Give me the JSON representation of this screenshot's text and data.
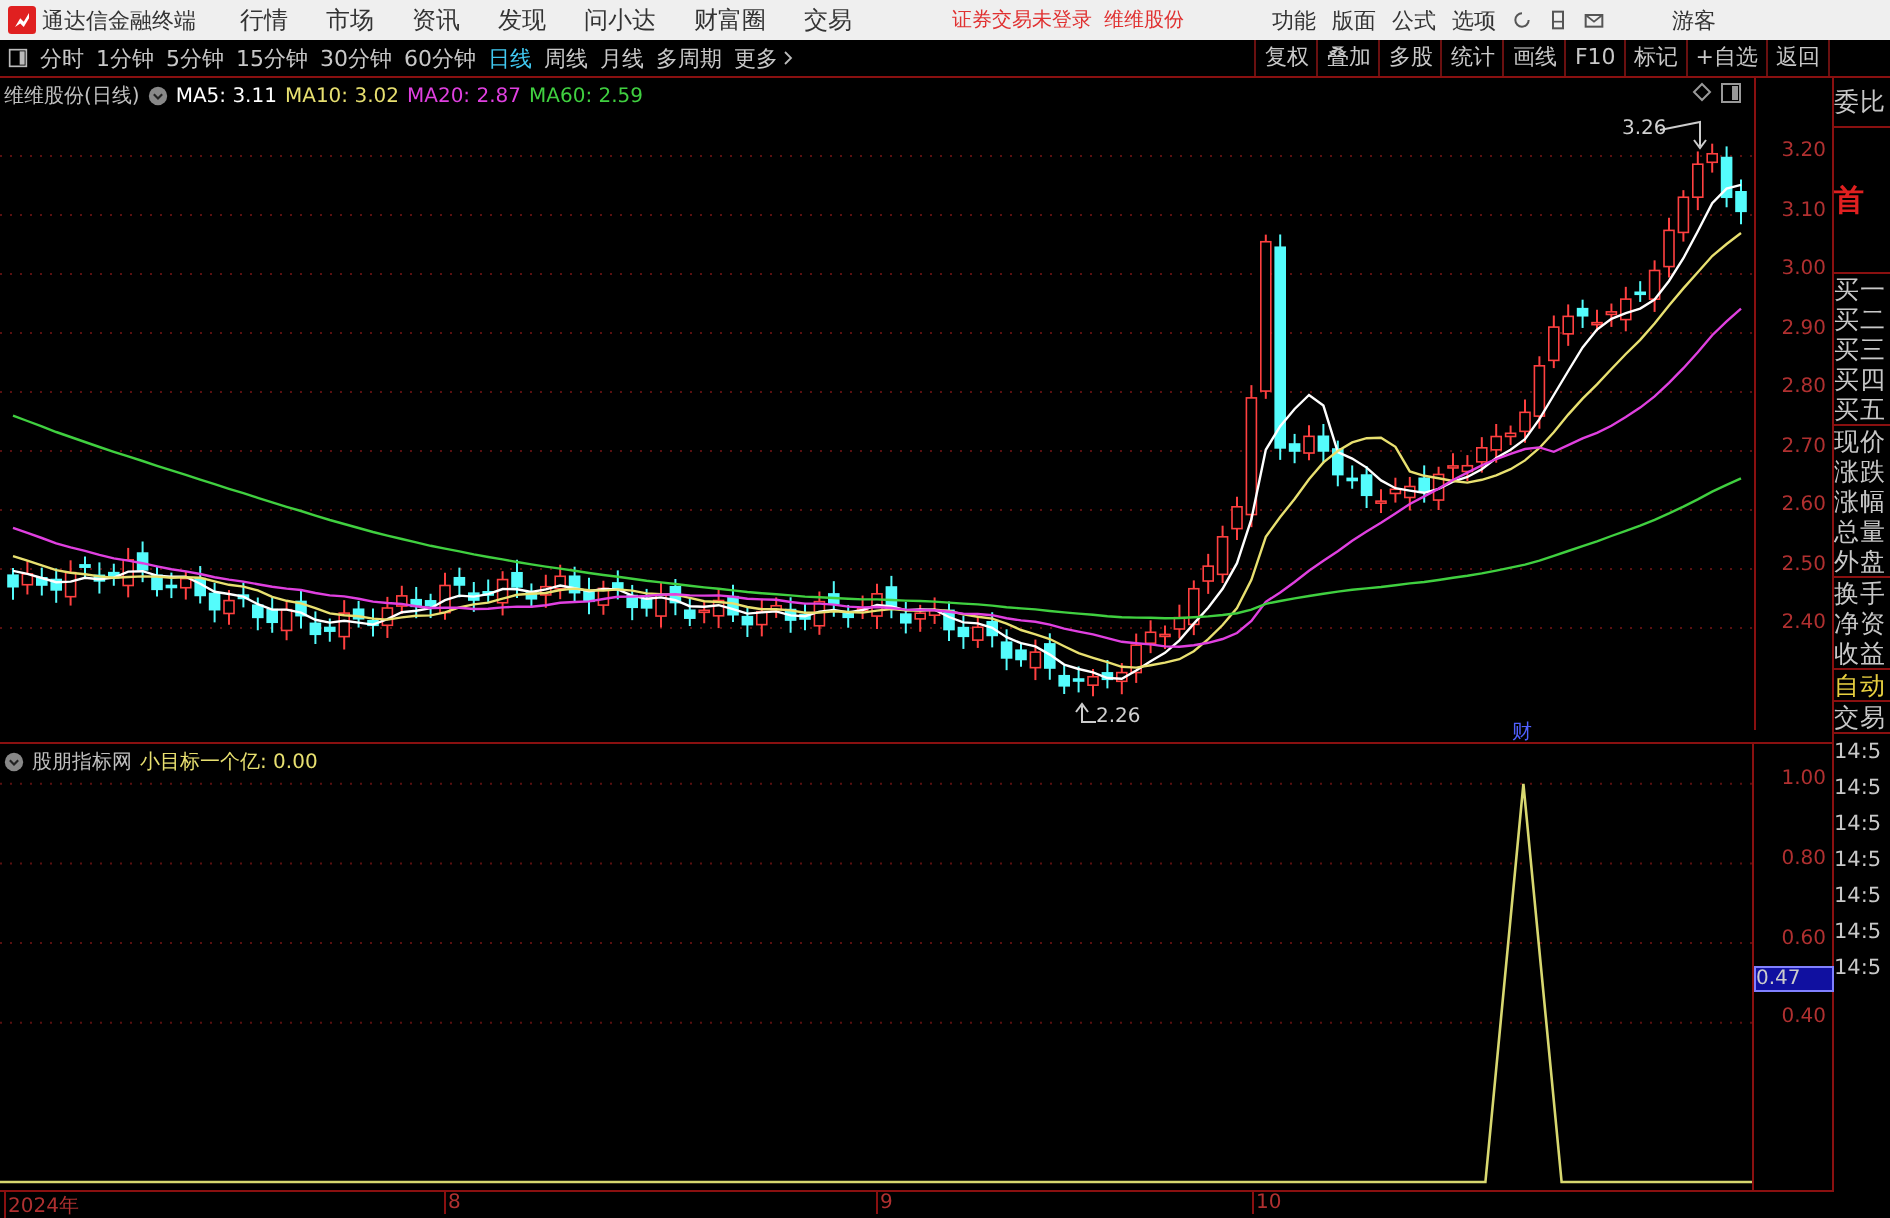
{
  "app": {
    "title": "通达信金融终端",
    "menu": [
      "行情",
      "市场",
      "资讯",
      "发现",
      "问小达",
      "财富圈",
      "交易"
    ],
    "status": "证券交易未登录",
    "stock": "维维股份",
    "right_menu": [
      "功能",
      "版面",
      "公式",
      "选项"
    ],
    "user": "游客"
  },
  "period_tabs": [
    {
      "label": "分时",
      "selected": false
    },
    {
      "label": "1分钟",
      "selected": false
    },
    {
      "label": "5分钟",
      "selected": false
    },
    {
      "label": "15分钟",
      "selected": false
    },
    {
      "label": "30分钟",
      "selected": false
    },
    {
      "label": "60分钟",
      "selected": false
    },
    {
      "label": "日线",
      "selected": true
    },
    {
      "label": "周线",
      "selected": false
    },
    {
      "label": "月线",
      "selected": false
    },
    {
      "label": "多周期",
      "selected": false
    },
    {
      "label": "更多",
      "selected": false
    }
  ],
  "tools": [
    "复权",
    "叠加",
    "多股",
    "统计",
    "画线",
    "F10",
    "标记",
    "+自选",
    "返回"
  ],
  "main_chart": {
    "name": "维维股份(日线)",
    "indicators": [
      {
        "label": "MA5: 3.11",
        "color": "#ffffff"
      },
      {
        "label": "MA10: 3.02",
        "color": "#e8e070"
      },
      {
        "label": "MA20: 2.87",
        "color": "#e040e0"
      },
      {
        "label": "MA60: 2.59",
        "color": "#40d040"
      }
    ],
    "yticks": [
      "3.20",
      "3.10",
      "3.00",
      "2.90",
      "2.80",
      "2.70",
      "2.60",
      "2.50",
      "2.40"
    ],
    "high_label": "3.26",
    "low_label": "2.26",
    "marker": "财"
  },
  "indicator_chart": {
    "name": "股朋指标网",
    "value_label": ": 0.00",
    "cursor_value": "0.47",
    "chart_data": {
      "type": "line",
      "ylim": [
        -0.02,
        1.1
      ],
      "grid": true,
      "yticks": [
        {
          "value": 0.4,
          "label": "0.40"
        },
        {
          "value": 0.6,
          "label": "0.60"
        },
        {
          "value": 0.8,
          "label": "0.80"
        },
        {
          "value": 1,
          "label": "1.00"
        }
      ],
      "series": [
        {
          "name": "小目标一个亿",
          "color": "#d8d870",
          "values": [
            0,
            0,
            0,
            0,
            0,
            0,
            0,
            0,
            0,
            0,
            0,
            0,
            0,
            0,
            0,
            0,
            0,
            0,
            0,
            0,
            0,
            0,
            0,
            0,
            0,
            0,
            0,
            0,
            0,
            0,
            0,
            0,
            0,
            0,
            0,
            0,
            0,
            0,
            0,
            0,
            1,
            0,
            0,
            0,
            0,
            0,
            0
          ]
        }
      ]
    }
  },
  "x_axis": [
    "2024年",
    "8",
    "9",
    "10"
  ],
  "quote_panel": {
    "groups": [
      {
        "kind": "label",
        "items": [
          "委比"
        ]
      },
      {
        "kind": "badge",
        "items": [
          "首"
        ]
      },
      {
        "kind": "label",
        "items": [
          "买一",
          "买二",
          "买三",
          "买四",
          "买五"
        ]
      },
      {
        "kind": "label",
        "items": [
          "现价",
          "涨跌",
          "涨幅",
          "总量",
          "外盘"
        ]
      },
      {
        "kind": "label",
        "items": [
          "换手",
          "净资",
          "收益"
        ]
      },
      {
        "kind": "accent",
        "items": [
          "自动"
        ]
      },
      {
        "kind": "label",
        "items": [
          "交易"
        ]
      },
      {
        "kind": "time",
        "items": [
          "14:5",
          "14:5",
          "14:5",
          "14:5",
          "14:5",
          "14:5",
          "14:5"
        ]
      }
    ]
  }
}
